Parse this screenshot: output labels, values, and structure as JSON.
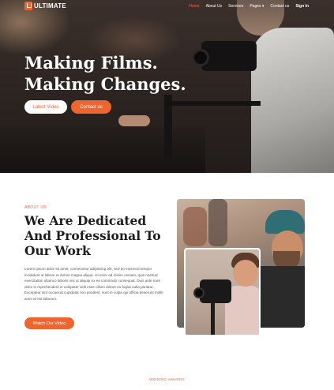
{
  "nav": {
    "logo_text": "ULTIMATE",
    "items": [
      "Home",
      "About Us",
      "Services",
      "Pages",
      "Contact us",
      "Sign In"
    ],
    "pages_caret": "▾"
  },
  "hero": {
    "title_line1": "Making Films.",
    "title_line2": "Making Changes.",
    "btn_latest": "Latest Video",
    "btn_contact": "Contact us"
  },
  "about": {
    "tag": "ABOUT US",
    "title": "We Are Dedicated And Professional To Our Work",
    "body": "Lorem ipsum dolor sit amet, consectetur adipiscing elit, sed do eiusmod tempor incididunt ut labore et dolore magna aliqua. Ut enim ad minim veniam, quis nostrud exercitation ullamco laboris nisi ut aliquip ex ea commodo consequat. Duis aute irure dolor in reprehenderit in voluptate velit esse cillum dolore eu fugiat nulla pariatur. Excepteur sint occaecat cupidatat non proident, sunt in culpa qui officia deserunt mollit anim id est laborum.",
    "btn_watch": "Watch Our Video"
  },
  "awards": {
    "tag": "WINNING AWARDS"
  },
  "colors": {
    "accent": "#ef6530",
    "hero_dark": "#2c2421"
  }
}
